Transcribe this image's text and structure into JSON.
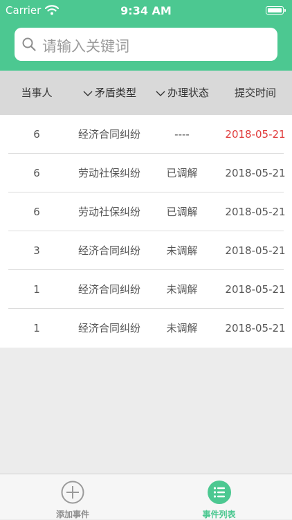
{
  "status_bar": {
    "carrier": "Carrier",
    "time": "9:34 AM"
  },
  "search": {
    "placeholder": "请输入关键词"
  },
  "table": {
    "headers": {
      "party": "当事人",
      "conflict_type": "矛盾类型",
      "status": "办理状态",
      "submit_time": "提交时间"
    },
    "rows": [
      {
        "party": "6",
        "type": "经济合同纠纷",
        "status": "----",
        "date": "2018-05-21"
      },
      {
        "party": "6",
        "type": "劳动社保纠纷",
        "status": "已调解",
        "date": "2018-05-21"
      },
      {
        "party": "6",
        "type": "劳动社保纠纷",
        "status": "已调解",
        "date": "2018-05-21"
      },
      {
        "party": "3",
        "type": "经济合同纠纷",
        "status": "未调解",
        "date": "2018-05-21"
      },
      {
        "party": "1",
        "type": "经济合同纠纷",
        "status": "未调解",
        "date": "2018-05-21"
      },
      {
        "party": "1",
        "type": "经济合同纠纷",
        "status": "未调解",
        "date": "2018-05-21"
      }
    ]
  },
  "tabbar": {
    "add_label": "添加事件",
    "list_label": "事件列表"
  },
  "colors": {
    "accent": "#4cc891",
    "highlight_date": "#e03a3a"
  }
}
